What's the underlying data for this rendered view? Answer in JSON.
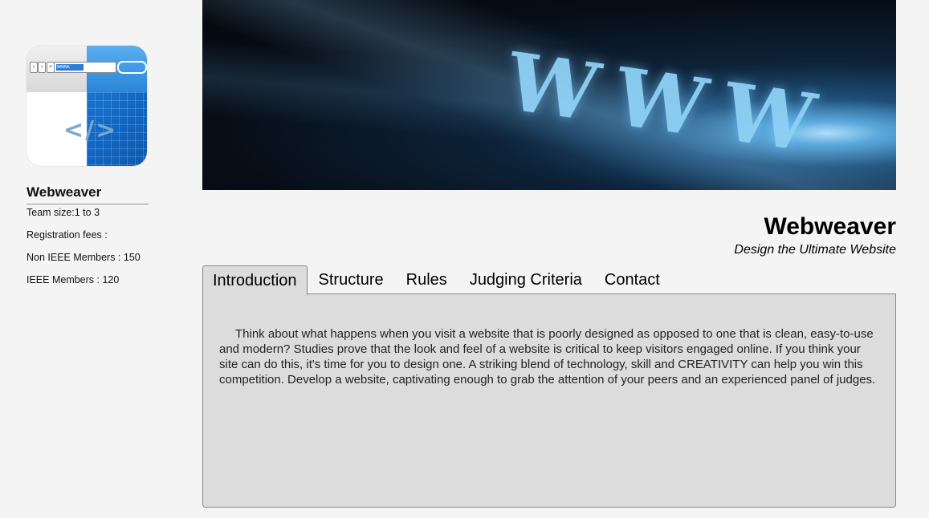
{
  "sidebar": {
    "logo": {
      "icon": "browser-code-icon",
      "url_text": "www.",
      "code_glyph": "</>"
    },
    "title": "Webweaver",
    "lines": [
      "Team size:1 to 3",
      "Registration fees :",
      "Non IEEE Members : 150",
      "IEEE Members : 120"
    ]
  },
  "banner": {
    "text": "WWW"
  },
  "header": {
    "title": "Webweaver",
    "subtitle": "Design the Ultimate Website"
  },
  "tabs": [
    {
      "label": "Introduction",
      "active": true
    },
    {
      "label": "Structure",
      "active": false
    },
    {
      "label": "Rules",
      "active": false
    },
    {
      "label": "Judging Criteria",
      "active": false
    },
    {
      "label": "Contact",
      "active": false
    }
  ],
  "panel": {
    "text": "Think about what happens when you visit a website that is poorly designed as opposed to one that is clean, easy-to-use and modern? Studies prove that the look and feel of a website is critical to keep visitors engaged online. If you think your site can do this, it's time for you to design one. A striking blend of technology, skill and CREATIVITY can help you win this competition. Develop a website, captivating enough to grab the attention of your peers and an experienced panel of judges."
  },
  "colors": {
    "background": "#f4f4f4",
    "panel": "#dcdcdc",
    "logo_blue": "#1f7fd6"
  }
}
